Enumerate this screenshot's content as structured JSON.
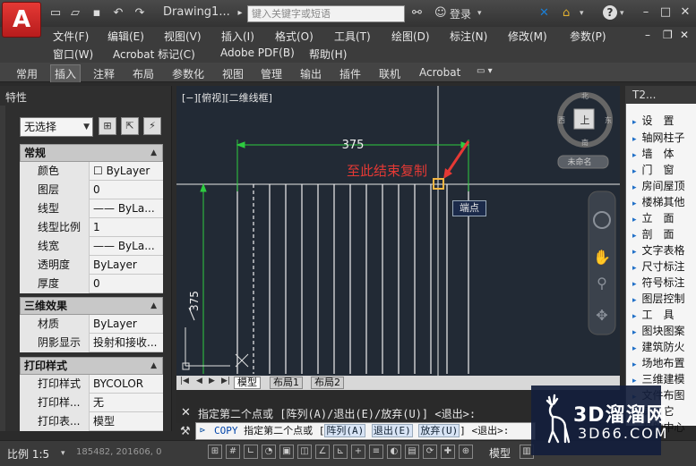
{
  "title_bar": {
    "doc_title": "Drawing1...",
    "search_placeholder": "键入关键字或短语",
    "login": "登录",
    "icons": [
      "new-file-icon",
      "open-folder-icon",
      "save-icon",
      "undo-icon",
      "redo-icon",
      "binoculars-icon",
      "user-icon",
      "x-icon",
      "lock-icon",
      "help-icon"
    ]
  },
  "menus": {
    "row1": [
      "文件(F)",
      "编辑(E)",
      "视图(V)",
      "插入(I)",
      "格式(O)",
      "工具(T)",
      "绘图(D)",
      "标注(N)",
      "修改(M)",
      "参数(P)"
    ],
    "row2": [
      "窗口(W)",
      "Acrobat 标记(C)",
      "Adobe PDF(B)",
      "帮助(H)"
    ]
  },
  "ribbon_tabs": [
    "常用",
    "插入",
    "注释",
    "布局",
    "参数化",
    "视图",
    "管理",
    "输出",
    "插件",
    "联机",
    "Acrobat"
  ],
  "ribbon_active": "插入",
  "properties": {
    "title": "特性",
    "selection": "无选择",
    "sections": {
      "general": {
        "label": "常规",
        "rows": [
          {
            "k": "颜色",
            "v": "☐ ByLayer"
          },
          {
            "k": "图层",
            "v": "0"
          },
          {
            "k": "线型",
            "v": "—— ByLa..."
          },
          {
            "k": "线型比例",
            "v": "1"
          },
          {
            "k": "线宽",
            "v": "—— ByLa..."
          },
          {
            "k": "透明度",
            "v": "ByLayer"
          },
          {
            "k": "厚度",
            "v": "0"
          }
        ]
      },
      "three_d": {
        "label": "三维效果",
        "rows": [
          {
            "k": "材质",
            "v": "ByLayer"
          },
          {
            "k": "阴影显示",
            "v": "投射和接收..."
          }
        ]
      },
      "plot": {
        "label": "打印样式",
        "rows": [
          {
            "k": "打印样式",
            "v": "BYCOLOR"
          },
          {
            "k": "打印样...",
            "v": "无"
          },
          {
            "k": "打印表...",
            "v": "模型"
          }
        ]
      }
    }
  },
  "canvas": {
    "view_label": "[−][俯视][二维线框]",
    "dim_horizontal": "375",
    "dim_vertical": "375",
    "annotation": "至此结束复制",
    "tooltip": "端点",
    "viewcube": {
      "north": "北",
      "south": "南",
      "west": "西",
      "east": "东",
      "face": "上",
      "wcs": "未命名"
    }
  },
  "layout_tabs": [
    "模型",
    "布局1",
    "布局2"
  ],
  "command": {
    "history": "指定第二个点或 [阵列(A)/退出(E)/放弃(U)] <退出>:",
    "prompt_cmd": "COPY",
    "prompt_text": "指定第二个点或 [",
    "opt1": "阵列(A)",
    "opt2": "退出(E)",
    "opt3": "放弃(U)",
    "prompt_end": "] <退出>:"
  },
  "tool_palette": {
    "title": "T2...",
    "items": [
      "设　置",
      "轴网柱子",
      "墙　体",
      "门　窗",
      "房间屋顶",
      "楼梯其他",
      "立　面",
      "剖　面",
      "文字表格",
      "尺寸标注",
      "符号标注",
      "图层控制",
      "工　具",
      "图块图案",
      "建筑防火",
      "场地布置",
      "三维建模",
      "文件布图",
      "其　它",
      "帮助中心"
    ]
  },
  "status_bar": {
    "scale": "比例 1:5",
    "coords": "185482, 201606, 0",
    "model": "模型"
  },
  "watermark": {
    "title": "3D溜溜网",
    "sub": "3D66.COM"
  }
}
